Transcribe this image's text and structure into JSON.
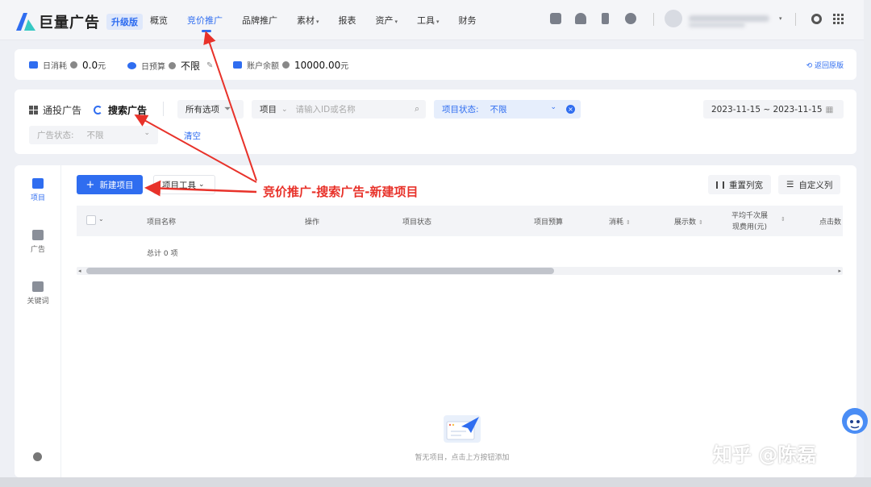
{
  "app": {
    "logo_text": "巨量广告",
    "tier_badge": "升级版"
  },
  "nav": {
    "items": [
      {
        "label": "概览",
        "caret": ""
      },
      {
        "label": "竞价推广",
        "caret": ""
      },
      {
        "label": "品牌推广",
        "caret": ""
      },
      {
        "label": "素材",
        "caret": "▾"
      },
      {
        "label": "报表",
        "caret": ""
      },
      {
        "label": "资产",
        "caret": "▾"
      },
      {
        "label": "工具",
        "caret": "▾"
      },
      {
        "label": "财务",
        "caret": ""
      }
    ]
  },
  "stats": {
    "daily_spend_label": "日消耗",
    "daily_spend_value": "0.0",
    "daily_spend_unit": "元",
    "daily_budget_label": "日预算",
    "daily_budget_value": "不限",
    "balance_label": "账户余额",
    "balance_value": "10000.00",
    "balance_unit": "元",
    "back_link": "返回原版"
  },
  "filters": {
    "tab_general": "通投广告",
    "tab_search": "搜索广告",
    "all_options": "所有选项",
    "scope": "项目",
    "search_placeholder": "请输入ID或名称",
    "project_status_label": "项目状态:",
    "project_status_value": "不限",
    "ad_status_label": "广告状态:",
    "ad_status_value": "不限",
    "clear": "清空",
    "date_range": "2023-11-15 ~ 2023-11-15"
  },
  "side_nav": {
    "items": [
      "项目",
      "广告",
      "关键词"
    ]
  },
  "toolbar": {
    "new_project": "新建项目",
    "project_tools": "项目工具",
    "reset_columns": "重置列宽",
    "custom_columns": "自定义列"
  },
  "table": {
    "columns": [
      "项目名称",
      "操作",
      "项目状态",
      "项目预算",
      "消耗",
      "展示数",
      "平均千次展",
      "现费用(元)",
      "点击数"
    ],
    "total": "总计 0 项"
  },
  "empty_state": {
    "text": "暂无项目，点击上方按钮添加"
  },
  "annotation": {
    "text": "竞价推广-搜索广告-新建项目"
  },
  "watermark": {
    "text": "知乎 @陈磊"
  }
}
